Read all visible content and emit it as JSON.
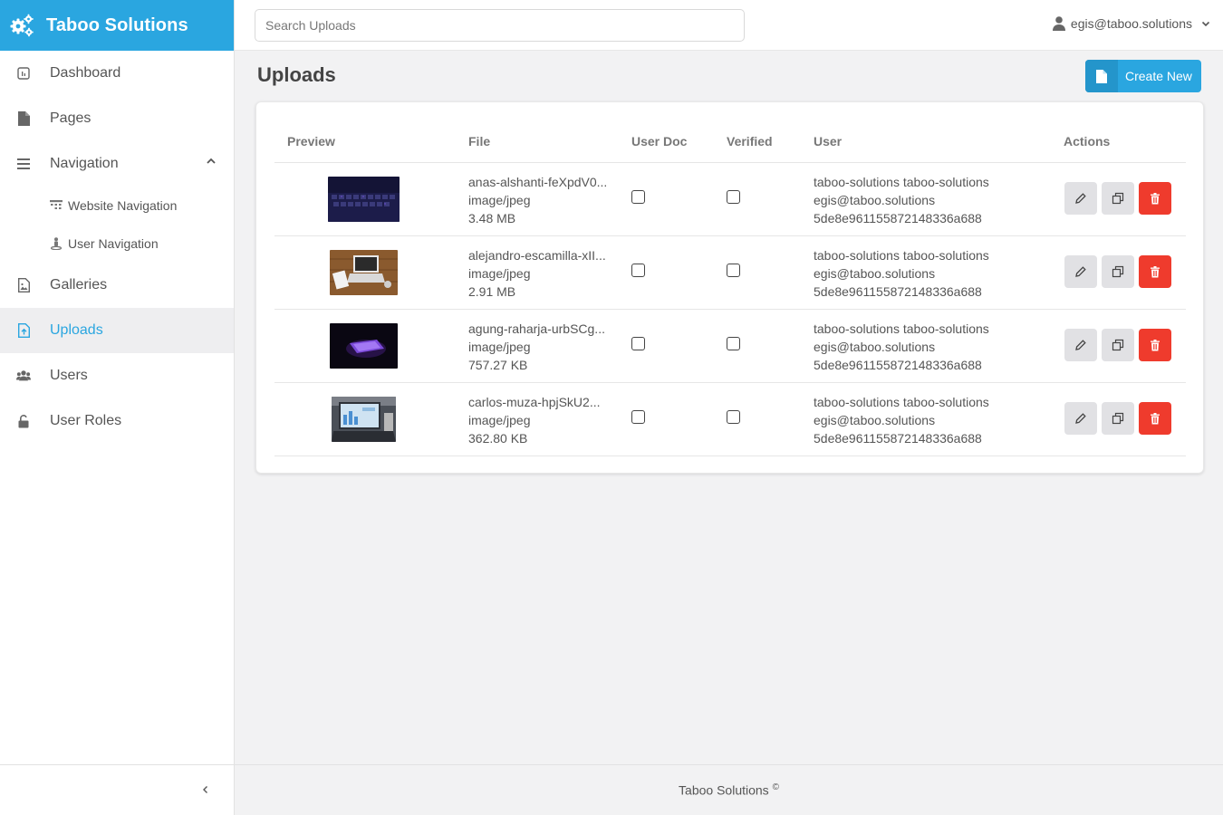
{
  "brand": {
    "name": "Taboo Solutions"
  },
  "search": {
    "placeholder": "Search Uploads"
  },
  "user_menu": {
    "email": "egis@taboo.solutions"
  },
  "sidebar": {
    "items": [
      {
        "label": "Dashboard"
      },
      {
        "label": "Pages"
      },
      {
        "label": "Navigation"
      },
      {
        "label": "Website Navigation"
      },
      {
        "label": "User Navigation"
      },
      {
        "label": "Galleries"
      },
      {
        "label": "Uploads",
        "active": true
      },
      {
        "label": "Users"
      },
      {
        "label": "User Roles"
      }
    ]
  },
  "page": {
    "title": "Uploads",
    "create_label": "Create New"
  },
  "table": {
    "headers": [
      "Preview",
      "File",
      "User Doc",
      "Verified",
      "User",
      "Actions"
    ],
    "rows": [
      {
        "name": "anas-alshanti-feXpdV0...",
        "type": "image/jpeg",
        "size": "3.48 MB",
        "user_name": "taboo-solutions taboo-solutions",
        "user_email": "egis@taboo.solutions",
        "user_id": "5de8e961155872148336a688",
        "user_doc": false,
        "verified": false,
        "preview_icon": "keyboard-photo"
      },
      {
        "name": "alejandro-escamilla-xII...",
        "type": "image/jpeg",
        "size": "2.91 MB",
        "user_name": "taboo-solutions taboo-solutions",
        "user_email": "egis@taboo.solutions",
        "user_id": "5de8e961155872148336a688",
        "user_doc": false,
        "verified": false,
        "preview_icon": "laptop-desk-photo"
      },
      {
        "name": "agung-raharja-urbSCg...",
        "type": "image/jpeg",
        "size": "757.27 KB",
        "user_name": "taboo-solutions taboo-solutions",
        "user_email": "egis@taboo.solutions",
        "user_id": "5de8e961155872148336a688",
        "user_doc": false,
        "verified": false,
        "preview_icon": "glowing-laptop-photo"
      },
      {
        "name": "carlos-muza-hpjSkU2...",
        "type": "image/jpeg",
        "size": "362.80 KB",
        "user_name": "taboo-solutions taboo-solutions",
        "user_email": "egis@taboo.solutions",
        "user_id": "5de8e961155872148336a688",
        "user_doc": false,
        "verified": false,
        "preview_icon": "laptop-dashboard-photo"
      }
    ]
  },
  "footer": {
    "text": "Taboo Solutions",
    "copyright_symbol": "©"
  },
  "colors": {
    "accent": "#2aa6e0",
    "danger": "#ef3b2d",
    "background": "#f2f2f3"
  }
}
